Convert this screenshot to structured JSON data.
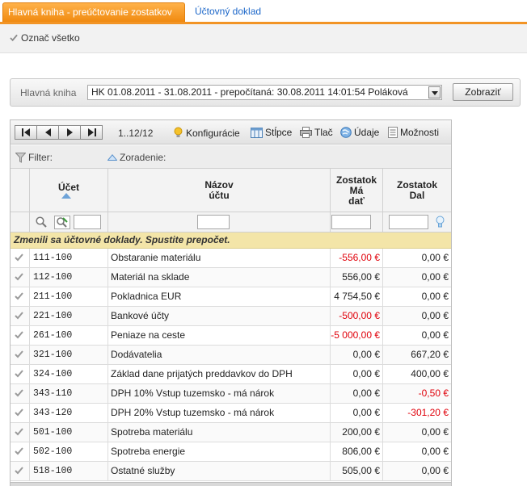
{
  "tabs": [
    {
      "label": "Hlavná kniha - preúčtovanie zostatkov",
      "active": true
    },
    {
      "label": "Účtovný doklad",
      "active": false
    }
  ],
  "toolbar": {
    "select_all_label": "Označ všetko"
  },
  "filter_panel": {
    "label": "Hlavná kniha",
    "selected": "HK 01.08.2011 - 31.08.2011 - prepočítaná: 30.08.2011 14:01:54 Poláková",
    "show_button": "Zobraziť"
  },
  "grid_toolbar": {
    "page_info": "1..12/12",
    "config": "Konfigurácie",
    "columns": "Stĺpce",
    "print": "Tlač",
    "data": "Údaje",
    "options": "Možnosti"
  },
  "grid_filter": {
    "filter_label": "Filter:",
    "sort_label": "Zoradenie:"
  },
  "columns": {
    "account": "Účet",
    "name_line1": "Názov",
    "name_line2": "účtu",
    "md_line1": "Zostatok",
    "md_line2": "Má",
    "md_line3": "dať",
    "d_line1": "Zostatok",
    "d_line2": "Dal"
  },
  "notice": "Zmenili sa účtovné doklady. Spustite prepočet.",
  "rows": [
    {
      "account": "111-100",
      "name": "Obstaranie materiálu",
      "md": "-556,00 €",
      "d": "0,00 €"
    },
    {
      "account": "112-100",
      "name": "Materiál na sklade",
      "md": "556,00 €",
      "d": "0,00 €"
    },
    {
      "account": "211-100",
      "name": "Pokladnica EUR",
      "md": "4 754,50 €",
      "d": "0,00 €"
    },
    {
      "account": "221-100",
      "name": "Bankové účty",
      "md": "-500,00 €",
      "d": "0,00 €"
    },
    {
      "account": "261-100",
      "name": "Peniaze na ceste",
      "md": "-5 000,00 €",
      "d": "0,00 €"
    },
    {
      "account": "321-100",
      "name": "Dodávatelia",
      "md": "0,00 €",
      "d": "667,20 €"
    },
    {
      "account": "324-100",
      "name": "Základ dane prijatých preddavkov do DPH",
      "md": "0,00 €",
      "d": "400,00 €"
    },
    {
      "account": "343-110",
      "name": "DPH 10% Vstup tuzemsko - má nárok",
      "md": "0,00 €",
      "d": "-0,50 €"
    },
    {
      "account": "343-120",
      "name": "DPH 20% Vstup tuzemsko - má nárok",
      "md": "0,00 €",
      "d": "-301,20 €"
    },
    {
      "account": "501-100",
      "name": "Spotreba materiálu",
      "md": "200,00 €",
      "d": "0,00 €"
    },
    {
      "account": "502-100",
      "name": "Spotreba energie",
      "md": "806,00 €",
      "d": "0,00 €"
    },
    {
      "account": "518-100",
      "name": "Ostatné služby",
      "md": "505,00 €",
      "d": "0,00 €"
    }
  ],
  "colors": {
    "accent": "#f29425",
    "link": "#1b66c9",
    "negative": "#e0000a",
    "notice_bg": "#f3e5a8"
  }
}
